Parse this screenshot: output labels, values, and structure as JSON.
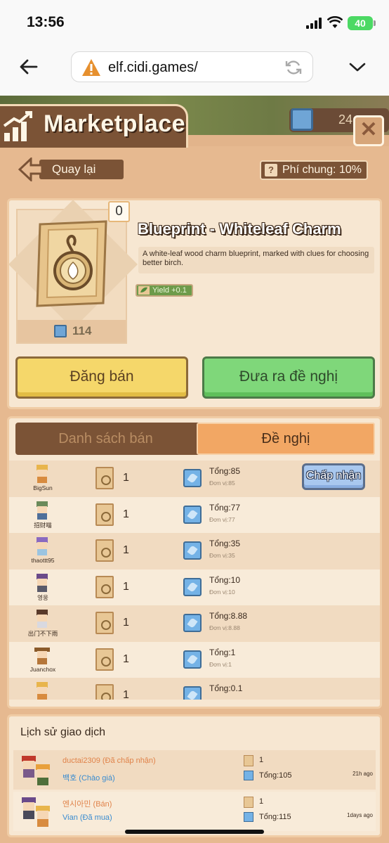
{
  "status": {
    "time": "13:56",
    "battery": "40"
  },
  "browser": {
    "url": "elf.cidi.games/"
  },
  "header": {
    "title": "Marketplace",
    "gem_balance": "24"
  },
  "nav": {
    "back_label": "Quay lại",
    "fee_label": "Phí chung: 10%",
    "fee_icon": "?"
  },
  "item": {
    "quantity": "0",
    "title": "Blueprint - Whiteleaf Charm",
    "description": "A white-leaf wood charm blueprint, marked with clues for choosing better birch.",
    "yield": "Yield +0.1",
    "price": "114"
  },
  "actions": {
    "sell_label": "Đăng bán",
    "offer_label": "Đưa ra đề nghị"
  },
  "tabs": {
    "listing": "Danh sách bán",
    "offers": "Đề nghị",
    "active": "offers"
  },
  "offers": [
    {
      "user": "BigSun",
      "qty": "1",
      "total": "Tổng:85",
      "unit": "Đơn vị:85",
      "action": "Chấp nhận"
    },
    {
      "user": "招财喵",
      "qty": "1",
      "total": "Tổng:77",
      "unit": "Đơn vị:77"
    },
    {
      "user": "thaottt95",
      "qty": "1",
      "total": "Tổng:35",
      "unit": "Đơn vị:35"
    },
    {
      "user": "영웅",
      "qty": "1",
      "total": "Tổng:10",
      "unit": "Đơn vị:10"
    },
    {
      "user": "出门不下雨",
      "qty": "1",
      "total": "Tổng:8.88",
      "unit": "Đơn vị:8.88"
    },
    {
      "user": "Juanchox",
      "qty": "1",
      "total": "Tổng:1",
      "unit": "Đơn vị:1"
    },
    {
      "user": "",
      "qty": "1",
      "total": "Tổng:0.1",
      "unit": ""
    }
  ],
  "history": {
    "title": "Lịch sử giao dịch",
    "rows": [
      {
        "seller": "ductai2309 (Đã chấp nhận)",
        "buyer": "백호 (Chào giá)",
        "qty": "1",
        "total": "Tổng:105",
        "time": "21h ago"
      },
      {
        "seller": "엔시아민 (Bán)",
        "buyer": "Vian (Đã mua)",
        "qty": "1",
        "total": "Tổng:115",
        "time": "1days ago"
      }
    ]
  },
  "colors": {
    "panel": "#f7e7d2",
    "frame": "#7b5336",
    "sell": "#f5d76a",
    "offer": "#7fd77a",
    "accept": "#a9c8ef"
  }
}
